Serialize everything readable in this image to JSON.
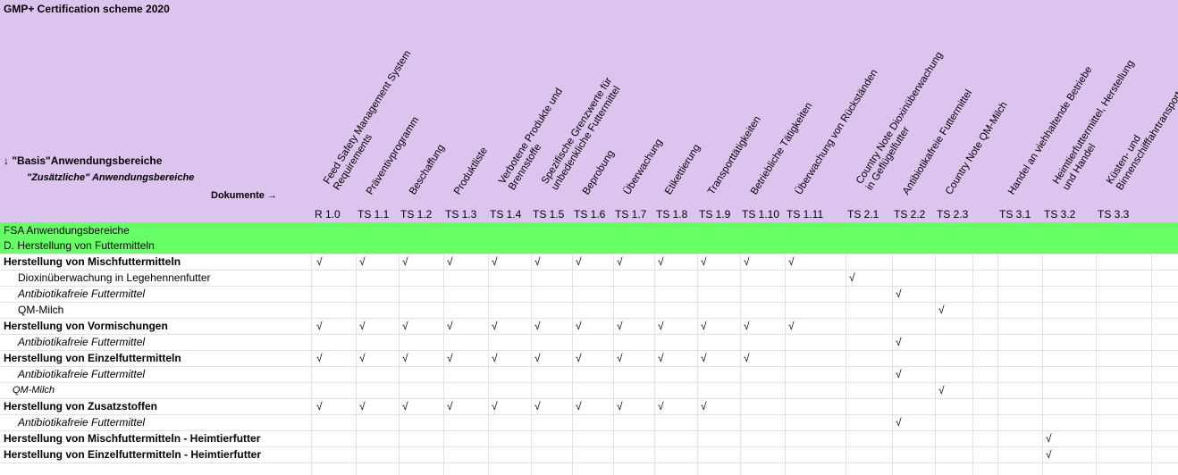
{
  "title": "GMP+ Certification scheme 2020",
  "basis_label": "↓ \"Basis\"Anwendungsbereiche",
  "zusatz_label": "\"Zusätzliche\" Anwendungsbereiche",
  "dokumente_label": "Dokumente →",
  "columns": [
    {
      "code": "R 1.0",
      "lines": [
        "Feed Safety Management System",
        "Requirements"
      ]
    },
    {
      "code": "TS 1.1",
      "lines": [
        "Präventivprogramm"
      ]
    },
    {
      "code": "TS 1.2",
      "lines": [
        "Beschaffung"
      ]
    },
    {
      "code": "TS 1.3",
      "lines": [
        "Produktliste"
      ]
    },
    {
      "code": "TS 1.4",
      "lines": [
        "Verbotene Produkte und",
        "Brennstoffe"
      ]
    },
    {
      "code": "TS 1.5",
      "lines": [
        "Spezifische Grenzwerte für",
        "unbedenkliche Futtermittel"
      ]
    },
    {
      "code": "TS 1.6",
      "lines": [
        "Beprobung"
      ]
    },
    {
      "code": "TS 1.7",
      "lines": [
        "Überwachung"
      ]
    },
    {
      "code": "TS 1.8",
      "lines": [
        "Etikettierung"
      ]
    },
    {
      "code": "TS 1.9",
      "lines": [
        "Transporttätigkeiten"
      ]
    },
    {
      "code": "TS 1.10",
      "lines": [
        "Betriebliche Tätigkeiten"
      ]
    },
    {
      "code": "TS 1.11",
      "lines": [
        "Überwachung von Rückständen"
      ]
    },
    {
      "code": "TS 2.1",
      "lines": [
        "Country Note Dioxinüberwachung",
        "in Geflügelfutter"
      ]
    },
    {
      "code": "TS 2.2",
      "lines": [
        "Antibiotikafreie Futtermittel"
      ]
    },
    {
      "code": "TS 2.3",
      "lines": [
        "Country Note QM-Milch"
      ]
    },
    {
      "code": "TS 3.1",
      "lines": [
        "Handel an viehhaltende Betriebe"
      ]
    },
    {
      "code": "TS 3.2",
      "lines": [
        "Heimtierfuttermittel, Herstellung",
        "und Handel"
      ]
    },
    {
      "code": "TS 3.3",
      "lines": [
        "Küsten- und",
        "Binnenschifffahrtransporte"
      ]
    }
  ],
  "green_rows": [
    "FSA Anwendungsbereiche",
    "D. Herstellung von Futtermitteln"
  ],
  "check_mark": "√",
  "rows": [
    {
      "label": "Herstellung von Mischfuttermitteln",
      "style": "bold",
      "checks": [
        0,
        1,
        2,
        3,
        4,
        5,
        6,
        7,
        8,
        9,
        10,
        11
      ]
    },
    {
      "label": "Dioxinüberwachung in Legehennenfutter",
      "style": "indent",
      "checks": [
        12
      ]
    },
    {
      "label": "Antibiotikafreie Futtermittel",
      "style": "italic",
      "checks": [
        13
      ]
    },
    {
      "label": "QM-Milch",
      "style": "indent",
      "checks": [
        14
      ]
    },
    {
      "label": "Herstellung von Vormischungen",
      "style": "bold",
      "checks": [
        0,
        1,
        2,
        3,
        4,
        5,
        6,
        7,
        8,
        9,
        10,
        11
      ]
    },
    {
      "label": "Antibiotikafreie Futtermittel",
      "style": "italic",
      "checks": [
        13
      ]
    },
    {
      "label": "Herstellung von Einzelfuttermitteln",
      "style": "bold",
      "checks": [
        0,
        1,
        2,
        3,
        4,
        5,
        6,
        7,
        8,
        9,
        10
      ]
    },
    {
      "label": "Antibiotikafreie Futtermittel",
      "style": "italic",
      "checks": [
        13
      ]
    },
    {
      "label": "QM-Milch",
      "style": "italic-small",
      "checks": [
        14
      ]
    },
    {
      "label": "Herstellung von Zusatzstoffen",
      "style": "bold",
      "checks": [
        0,
        1,
        2,
        3,
        4,
        5,
        6,
        7,
        8,
        9
      ]
    },
    {
      "label": "Antibiotikafreie Futtermittel",
      "style": "italic",
      "checks": [
        13
      ]
    },
    {
      "label": "Herstellung von Mischfuttermitteln - Heimtierfutter",
      "style": "bold",
      "checks": [
        16
      ]
    },
    {
      "label": "Herstellung von Einzelfuttermitteln - Heimtierfutter",
      "style": "bold",
      "checks": [
        16
      ]
    }
  ]
}
